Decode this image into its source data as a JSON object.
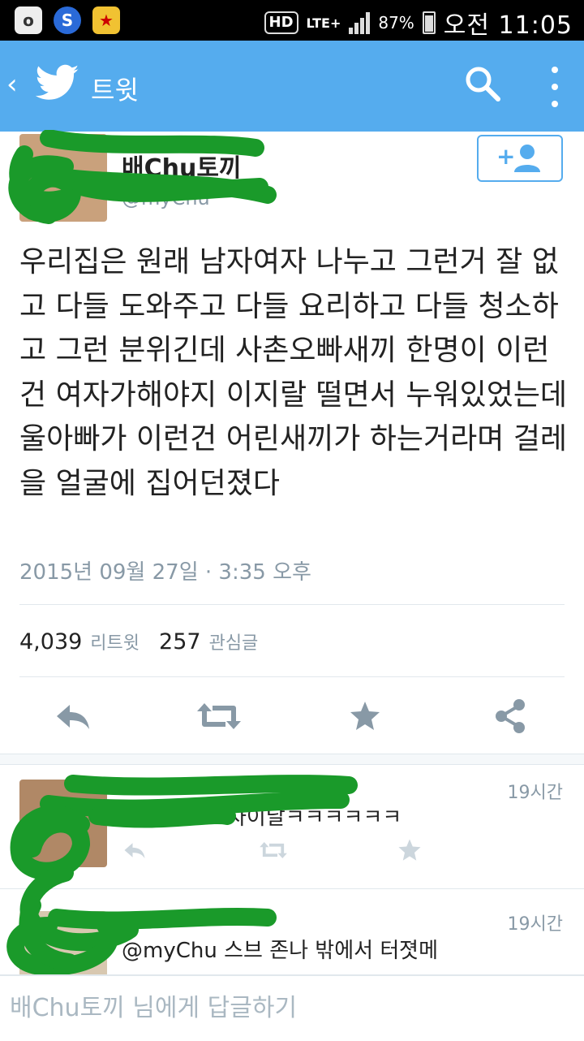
{
  "status_bar": {
    "battery": "87%",
    "network": "LTE+",
    "hd": "HD",
    "time": "오전 11:05",
    "apps": [
      "o-app-icon",
      "s-app-icon",
      "game-app-icon"
    ]
  },
  "app_bar": {
    "title": "트윗",
    "icons": [
      "back-chevron-icon",
      "twitter-bird-icon",
      "search-icon",
      "more-vert-icon"
    ],
    "color": "#55acee"
  },
  "tweet": {
    "author_name": "배Chu토끼",
    "author_handle": "@myChu",
    "text": "우리집은 원래 남자여자 나누고 그런거 잘 없고 다들 도와주고 다들 요리하고 다들 청소하고 그런 분위긴데 사촌오빠새끼 한명이 이런건 여자가해야지 이지랄 떨면서 누워있었는데 울아빠가 이런건 어린새끼가 하는거라며 걸레을 얼굴에 집어던졌다",
    "date": "2015년 09월 27일 · 3:35 오후",
    "retweets": "4,039",
    "retweets_label": "리트윗",
    "favorites": "257",
    "favorites_label": "관심글"
  },
  "replies": [
    {
      "name": "",
      "time": "19시간",
      "text": "자이날ㅋㅋㅋㅋㅋㅋ"
    },
    {
      "name": "",
      "time": "19시간",
      "text": "@myChu 스브 존나 밖에서 터졋메"
    }
  ],
  "compose": {
    "placeholder": "배Chu토끼 님에게 답글하기"
  },
  "colors": {
    "accent": "#55acee",
    "muted": "#8899a6",
    "scribble": "#1a9a2a"
  }
}
